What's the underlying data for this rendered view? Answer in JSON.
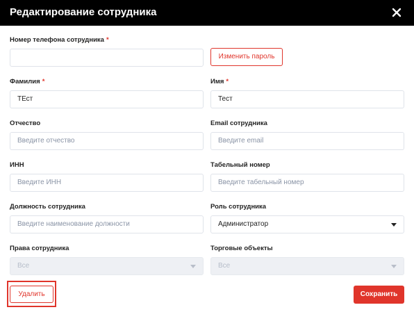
{
  "dialog": {
    "title": "Редактирование сотрудника"
  },
  "fields": {
    "phone": {
      "label": "Номер телефона сотрудника",
      "value": ""
    },
    "change_password_label": "Изменить пароль",
    "last_name": {
      "label": "Фамилия",
      "value": "ТЕст"
    },
    "first_name": {
      "label": "Имя",
      "value": "Тест"
    },
    "middle_name": {
      "label": "Отчество",
      "placeholder": "Введите отчество"
    },
    "email": {
      "label": "Email сотрудника",
      "placeholder": "Введите email"
    },
    "inn": {
      "label": "ИНН",
      "placeholder": "Введите ИНН"
    },
    "personnel_number": {
      "label": "Табельный номер",
      "placeholder": "Введите табельный номер"
    },
    "position": {
      "label": "Должность сотрудника",
      "placeholder": "Введите наименование должности"
    },
    "role": {
      "label": "Роль сотрудника",
      "value": "Администратор"
    },
    "rights": {
      "label": "Права сотрудника",
      "value": "Все"
    },
    "stores": {
      "label": "Торговые объекты",
      "value": "Все"
    }
  },
  "required_mark": "*",
  "footer": {
    "delete_label": "Удалить",
    "save_label": "Сохранить"
  },
  "colors": {
    "accent": "#e0352b",
    "header_bg": "#000000"
  }
}
